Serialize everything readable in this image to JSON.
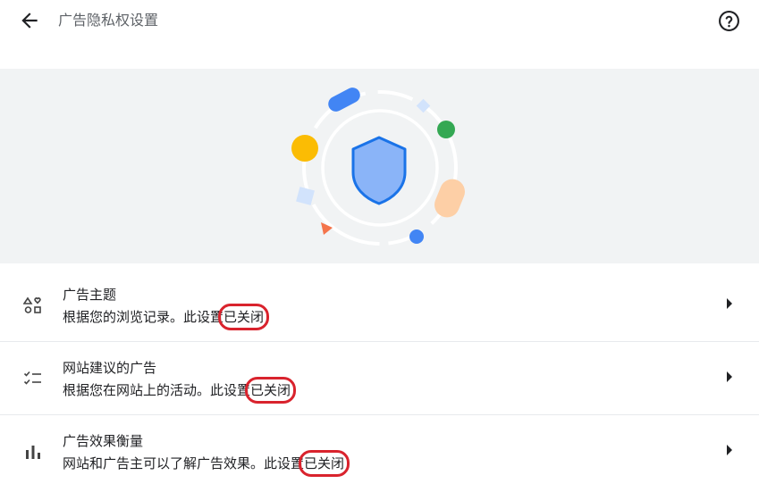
{
  "header": {
    "title": "广告隐私权设置",
    "back_icon": "arrow-back-icon",
    "help_icon": "help-circle-icon"
  },
  "hero": {
    "illustration": "privacy-shield-illustration",
    "colors": {
      "background": "#f1f3f4",
      "shield": "#8ab4f8",
      "shield_border": "#1a73e8",
      "blue_pill": "#4285f4",
      "yellow_dot": "#fbbc04",
      "green_dot": "#34a853",
      "peach_pill": "#fdcfa6",
      "orange_triangle": "#f4744b",
      "light_blue": "#d2e3fc"
    }
  },
  "settings": [
    {
      "title": "广告主题",
      "desc_prefix": "根据您的浏览记录。此设置",
      "status": "已关闭",
      "icon": "topics-shapes-icon"
    },
    {
      "title": "网站建议的广告",
      "desc_prefix": "根据您在网站上的活动。此设置",
      "status": "已关闭",
      "icon": "checklist-icon"
    },
    {
      "title": "广告效果衡量",
      "desc_prefix": "网站和广告主可以了解广告效果。此设置",
      "status": "已关闭",
      "icon": "bar-chart-icon"
    }
  ],
  "accent": {
    "annotation_red": "#d9232d",
    "divider": "#e8eaed"
  }
}
